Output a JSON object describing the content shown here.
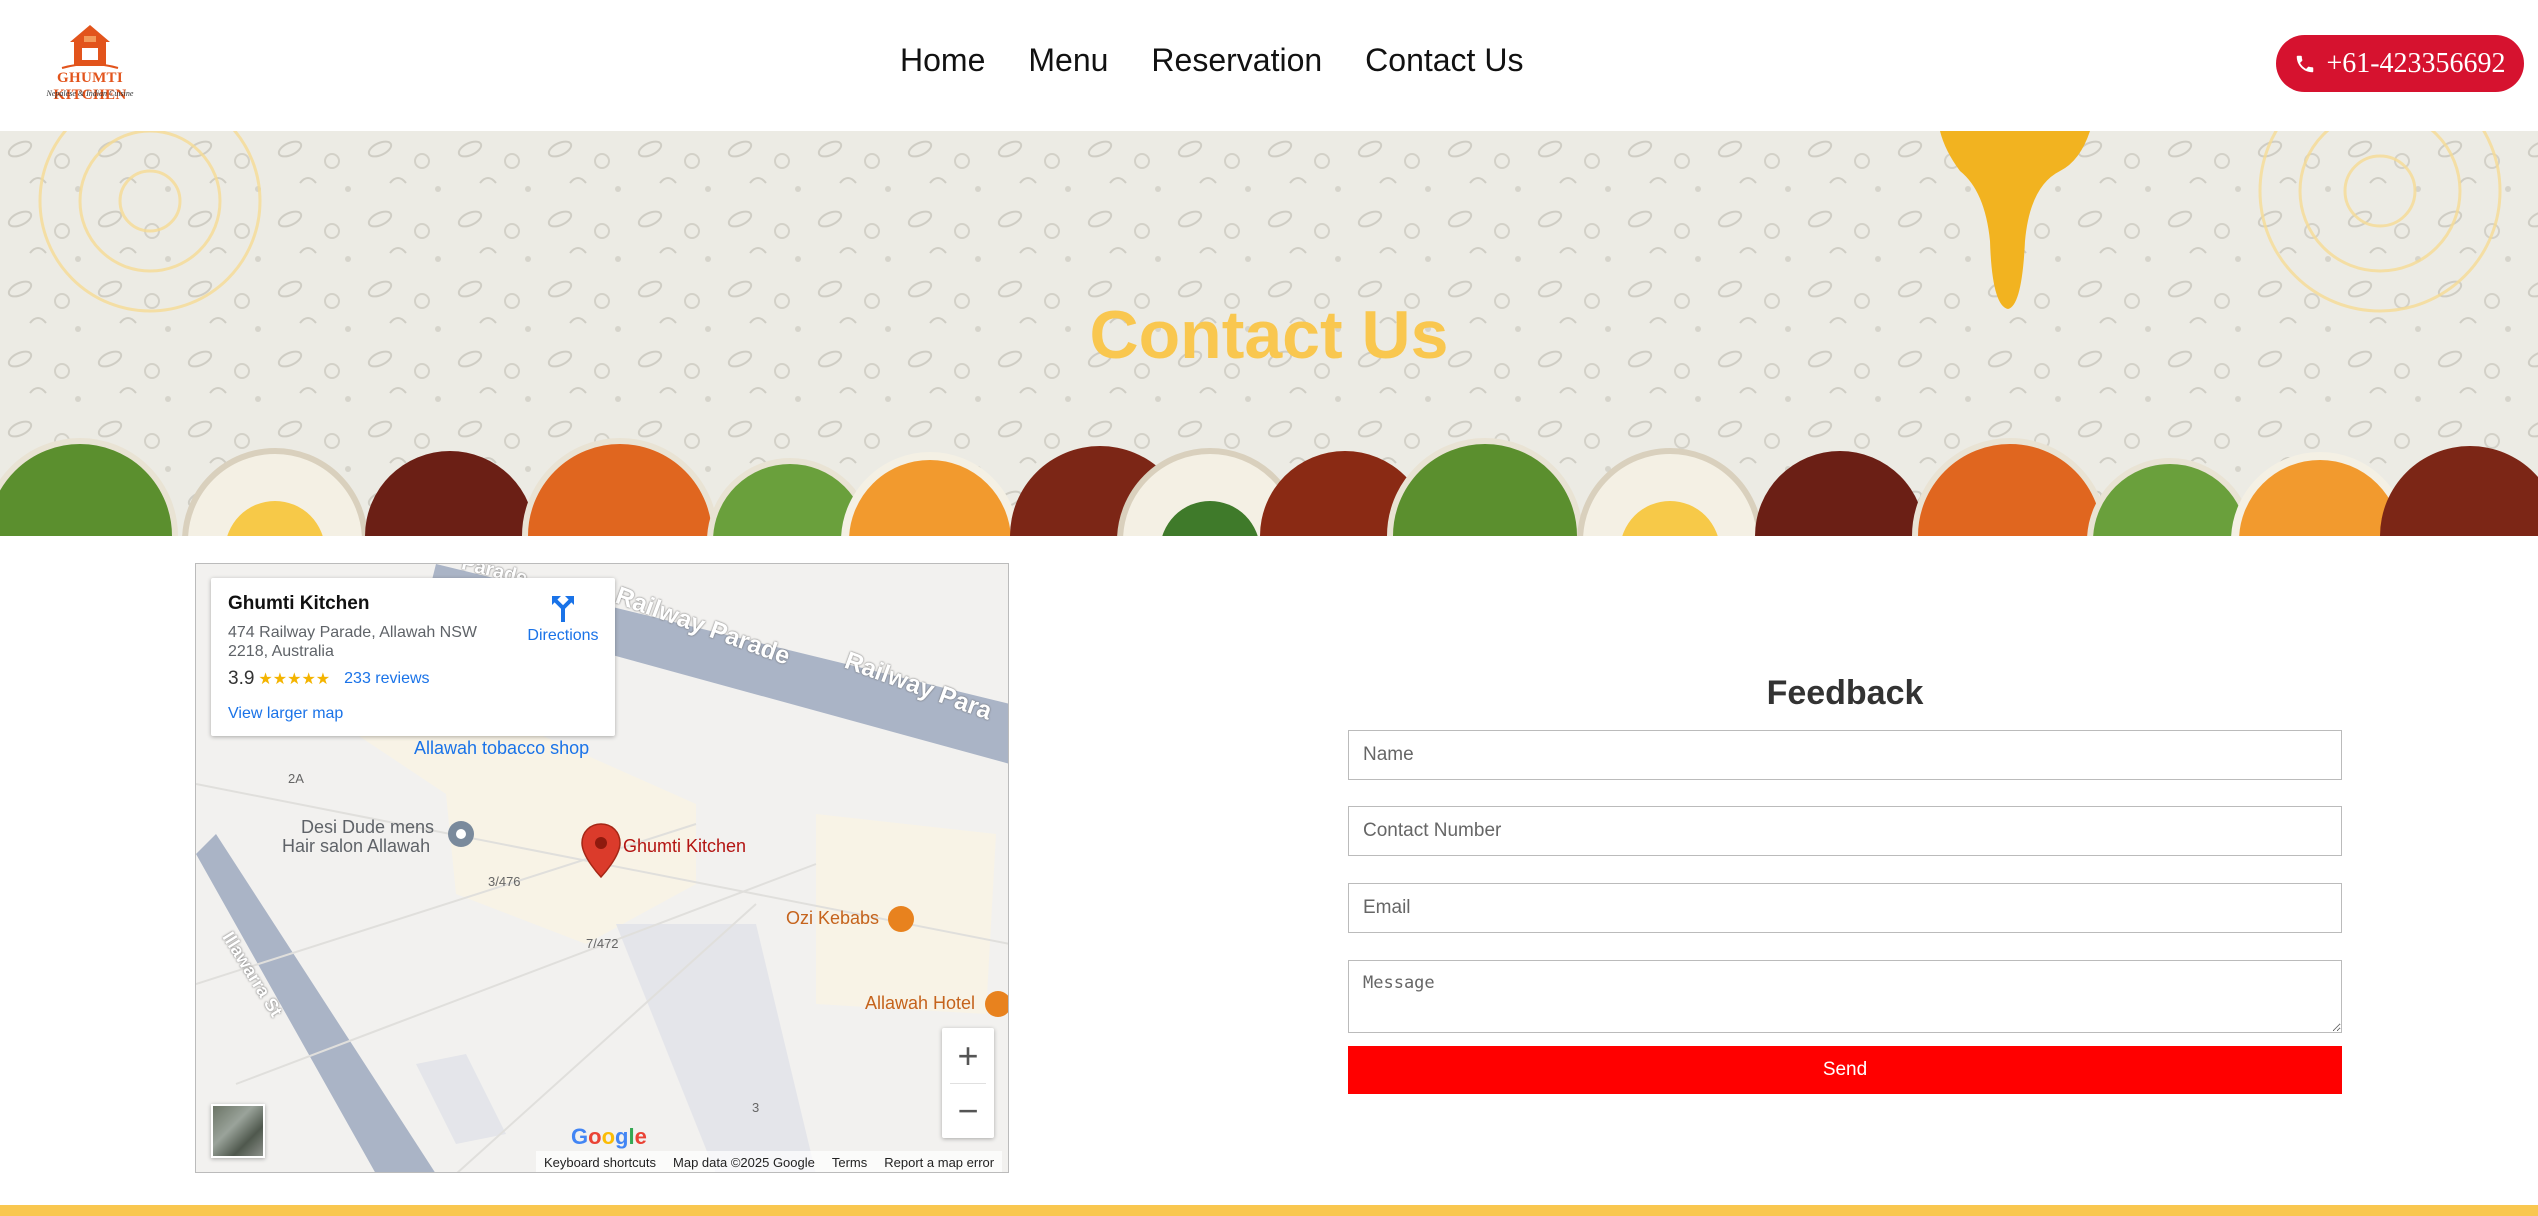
{
  "header": {
    "logo_title": "GHUMTI KITCHEN",
    "logo_subtitle": "Nepalese & Indian Cuisine",
    "nav": [
      "Home",
      "Menu",
      "Reservation",
      "Contact Us"
    ],
    "phone": "+61-423356692",
    "brand_color": "#d6122f"
  },
  "banner": {
    "title": "Contact Us",
    "title_color": "#f9c74f"
  },
  "map": {
    "place_name": "Ghumti Kitchen",
    "address": "474 Railway Parade, Allawah NSW 2218, Australia",
    "rating": "3.9",
    "stars": "★★★★★",
    "reviews": "233 reviews",
    "directions": "Directions",
    "view_larger": "View larger map",
    "labels": {
      "railway_1": "Railway Parade",
      "railway_2": "Railway Para",
      "railway_top": "Parade",
      "tobacco": "Allawah tobacco shop",
      "desi_1": "Desi Dude mens",
      "desi_2": "Hair salon Allawah",
      "pin": "Ghumti Kitchen",
      "ozi": "Ozi Kebabs",
      "hotel": "Allawah Hotel",
      "illawarra": "Illawarra St",
      "n2a": "2A",
      "n3476": "3/476",
      "n7472": "7/472",
      "n3": "3"
    },
    "zoom_in": "+",
    "zoom_out": "−",
    "google": [
      "G",
      "o",
      "o",
      "g",
      "l",
      "e"
    ],
    "footer": {
      "shortcuts": "Keyboard shortcuts",
      "mapdata": "Map data ©2025 Google",
      "terms": "Terms",
      "report": "Report a map error"
    }
  },
  "feedback": {
    "title": "Feedback",
    "name_placeholder": "Name",
    "contact_placeholder": "Contact Number",
    "email_placeholder": "Email",
    "message_placeholder": "Message",
    "send_label": "Send",
    "send_color": "#ff0000"
  }
}
